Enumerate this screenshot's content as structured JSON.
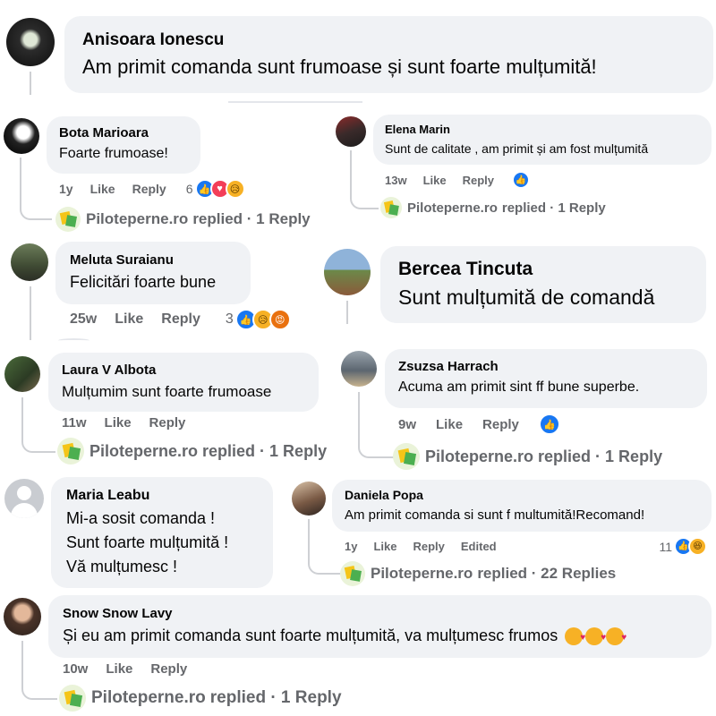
{
  "common": {
    "like": "Like",
    "reply": "Reply",
    "edited": "Edited"
  },
  "comments": [
    {
      "id": "c1",
      "author": "Anisoara Ionescu",
      "text": "Am primit comanda sunt frumoase și sunt foarte mulțumită!"
    },
    {
      "id": "c2",
      "author": "Bota Marioara",
      "text": "Foarte frumoase!",
      "time": "1y",
      "reaction_count": "6",
      "reactions": [
        "like-icon",
        "love-icon",
        "sad-icon"
      ],
      "reply_author": "Piloteperne.ro",
      "reply_text": "replied · 1 Reply"
    },
    {
      "id": "c3",
      "author": "Elena Marin",
      "text": "Sunt de calitate , am primit și am fost mulțumită",
      "time": "13w",
      "reactions": [
        "like-icon"
      ],
      "reply_author": "Piloteperne.ro",
      "reply_text": "replied · 1 Reply"
    },
    {
      "id": "c4",
      "author": "Meluta Suraianu",
      "text": "Felicitări foarte bune",
      "time": "25w",
      "reaction_count": "3",
      "reactions": [
        "like-icon",
        "sad-icon",
        "angry-icon"
      ]
    },
    {
      "id": "c5",
      "author": "Bercea Tincuta",
      "text": "Sunt mulțumită de comandă"
    },
    {
      "id": "c6",
      "author": "Laura V Albota",
      "text": "Mulțumim sunt foarte frumoase",
      "time": "11w",
      "reply_author": "Piloteperne.ro",
      "reply_text": "replied · 1 Reply"
    },
    {
      "id": "c7",
      "author": "Zsuzsa Harrach",
      "text": "Acuma am primit sint ff bune superbe.",
      "time": "9w",
      "reactions": [
        "like-icon"
      ],
      "reply_author": "Piloteperne.ro",
      "reply_text": "replied · 1 Reply"
    },
    {
      "id": "c8",
      "author": "Maria Leabu",
      "lines": [
        "Mi-a sosit comanda !",
        "Sunt foarte mulțumită !",
        "Vă mulțumesc !"
      ]
    },
    {
      "id": "c9",
      "author": "Daniela Popa",
      "text": "Am primit comanda si sunt f multumită!Recomand!",
      "time": "1y",
      "reaction_count": "11",
      "reactions": [
        "like-icon",
        "haha-icon"
      ],
      "reply_author": "Piloteperne.ro",
      "reply_text": "replied · 22 Replies"
    },
    {
      "id": "c10",
      "author": "Snow Snow Lavy",
      "text": "Și eu am primit comanda sunt foarte mulțumită, va mulțumesc frumos",
      "time": "10w",
      "emojis": [
        "smiling-face-with-hearts-icon",
        "smiling-face-with-hearts-icon",
        "smiling-face-with-hearts-icon"
      ],
      "reply_author": "Piloteperne.ro",
      "reply_text": "replied · 1 Reply"
    }
  ]
}
